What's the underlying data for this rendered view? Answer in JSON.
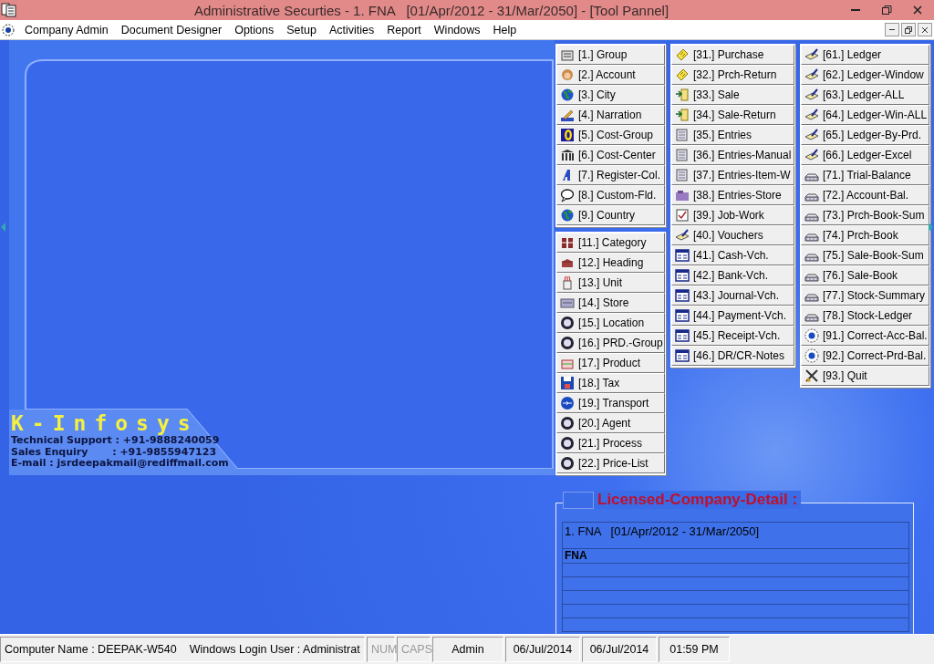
{
  "window": {
    "title": "Administrative Securties - 1. FNA   [01/Apr/2012 - 31/Mar/2050] - [Tool Pannel]"
  },
  "menu": [
    "Company Admin",
    "Document Designer",
    "Options",
    "Setup",
    "Activities",
    "Report",
    "Windows",
    "Help"
  ],
  "brand": {
    "name": "K-Infosys",
    "lines": [
      "Technical Support : +91-9888240059",
      "Sales Enquiry       : +91-9855947123",
      "E-mail : jsrdeepakmail@rediffmail.com"
    ]
  },
  "tool_panel": {
    "columns": [
      {
        "groups": [
          [
            "[1.] Group",
            "[2.] Account",
            "[3.] City",
            "[4.] Narration",
            "[5.] Cost-Group",
            "[6.] Cost-Center",
            "[7.] Register-Col.",
            "[8.] Custom-Fld.",
            "[9.] Country"
          ],
          [
            "[11.] Category",
            "[12.] Heading",
            "[13.] Unit",
            "[14.] Store",
            "[15.] Location",
            "[16.] PRD.-Group",
            "[17.] Product",
            "[18.] Tax",
            "[19.] Transport",
            "[20.] Agent",
            "[21.] Process",
            "[22.] Price-List"
          ]
        ]
      },
      {
        "groups": [
          [
            "[31.] Purchase",
            "[32.] Prch-Return",
            "[33.] Sale",
            "[34.] Sale-Return",
            "[35.] Entries",
            "[36.] Entries-Manual",
            "[37.] Entries-Item-W",
            "[38.] Entries-Store",
            "[39.] Job-Work",
            "[40.] Vouchers",
            "[41.] Cash-Vch.",
            "[42.] Bank-Vch.",
            "[43.] Journal-Vch.",
            "[44.] Payment-Vch.",
            "[45.] Receipt-Vch.",
            "[46.] DR/CR-Notes"
          ]
        ]
      },
      {
        "groups": [
          [
            "[61.] Ledger",
            "[62.] Ledger-Window",
            "[63.] Ledger-ALL",
            "[64.] Ledger-Win-ALL",
            "[65.] Ledger-By-Prd.",
            "[66.] Ledger-Excel",
            "[71.] Trial-Balance",
            "[72.] Account-Bal.",
            "[73.] Prch-Book-Sum",
            "[74.] Prch-Book",
            "[75.] Sale-Book-Sum",
            "[76.] Sale-Book",
            "[77.] Stock-Summary",
            "[78.] Stock-Ledger",
            "[91.] Correct-Acc-Bal.",
            "[92.] Correct-Prd-Bal.",
            "[93.] Quit"
          ]
        ]
      }
    ]
  },
  "license": {
    "title": "Licensed-Company-Detail :",
    "rows": [
      "1. FNA   [01/Apr/2012 - 31/Mar/2050]",
      "FNA"
    ]
  },
  "status_bar": {
    "computer": "Computer Name : DEEPAK-W540",
    "user": "Windows Login User : Administrat",
    "keys": [
      {
        "label": "NUM",
        "on": false
      },
      {
        "label": "CAPS",
        "on": false
      }
    ],
    "cells": [
      "Admin",
      "06/Jul/2014",
      "06/Jul/2014",
      "01:59 PM"
    ]
  }
}
